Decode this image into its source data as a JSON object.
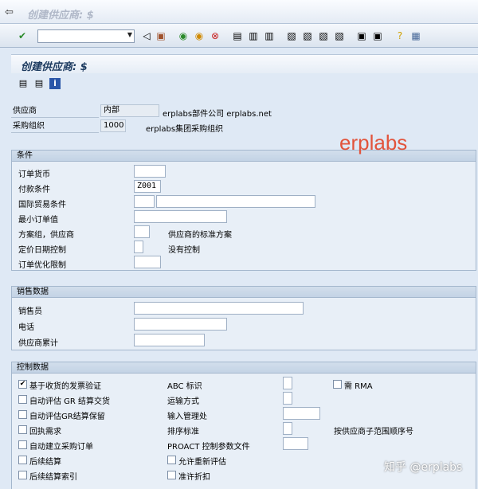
{
  "window": {
    "title": "创建供应商: $"
  },
  "toolbar": {
    "command_value": ""
  },
  "screen": {
    "title": "创建供应商: $"
  },
  "header": {
    "vendor_label": "供应商",
    "vendor_value": "内部",
    "vendor_desc": "erplabs部件公司 erplabs.net",
    "porg_label": "采购组织",
    "porg_value": "1000",
    "porg_desc": "erplabs集团采购组织"
  },
  "conditions": {
    "title": "条件",
    "order_currency_label": "订单货币",
    "order_currency_value": "",
    "payment_terms_label": "付款条件",
    "payment_terms_value": "Z001",
    "incoterms_label": "国际贸易条件",
    "incoterms_value1": "",
    "incoterms_value2": "",
    "min_order_label": "最小订单值",
    "min_order_value": "",
    "schema_group_label": "方案组，供应商",
    "schema_group_value": "",
    "schema_group_desc": "供应商的标准方案",
    "pricing_date_label": "定价日期控制",
    "pricing_date_value": "",
    "pricing_date_desc": "没有控制",
    "order_opt_label": "订单优化限制",
    "order_opt_value": ""
  },
  "sales": {
    "title": "销售数据",
    "salesperson_label": "销售员",
    "salesperson_value": "",
    "phone_label": "电话",
    "phone_value": "",
    "acct_label": "供应商累计",
    "acct_value": ""
  },
  "control": {
    "title": "控制数据",
    "gr_iv_label": "基于收货的发票验证",
    "gr_iv_checked": true,
    "ers_label": "自动评估 GR 结算交货",
    "ers_checked": false,
    "ers_reserve_label": "自动评估GR结算保留",
    "ers_reserve_checked": false,
    "ack_label": "回执需求",
    "ack_checked": false,
    "auto_po_label": "自动建立采购订单",
    "auto_po_checked": false,
    "subseq_label": "后续结算",
    "subseq_checked": false,
    "subseq_index_label": "后续结算索引",
    "subseq_index_checked": false,
    "abc_label": "ABC 标识",
    "abc_value": "",
    "rma_label": "需 RMA",
    "rma_checked": false,
    "shipping_label": "运输方式",
    "shipping_value": "",
    "office_label": "输入管理处",
    "office_value": "",
    "sort_label": "排序标准",
    "sort_value": "",
    "sort_desc": "按供应商子范围顺序号",
    "proact_label": "PROACT 控制参数文件",
    "proact_value": "",
    "reval_label": "允许重新评估",
    "reval_checked": false,
    "discount_label": "准许折扣",
    "discount_checked": false
  },
  "watermark": {
    "text": "erplabs",
    "footer": "知乎 @erplabs"
  }
}
